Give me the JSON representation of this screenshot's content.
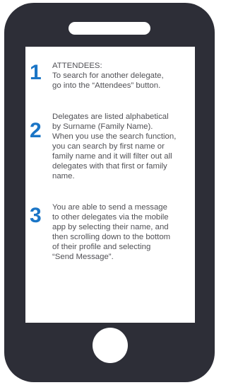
{
  "steps": [
    {
      "number": "1",
      "text": "ATTENDEES:\nTo search for another delegate,\ngo into the “Attendees” button."
    },
    {
      "number": "2",
      "text": "Delegates are listed alphabetical\nby Surname (Family Name).\nWhen you use the search function,\nyou can search by first name or\nfamily name and it will filter out all\ndelegates with that first or family\nname."
    },
    {
      "number": "3",
      "text": "You are able to send a message\nto other delegates via the mobile\napp by selecting their name, and\nthen scrolling down to the bottom\nof their profile and selecting\n“Send Message”."
    }
  ],
  "colors": {
    "phone_body": "#2d2e37",
    "accent_number": "#1a75c6",
    "body_text": "#505055"
  }
}
